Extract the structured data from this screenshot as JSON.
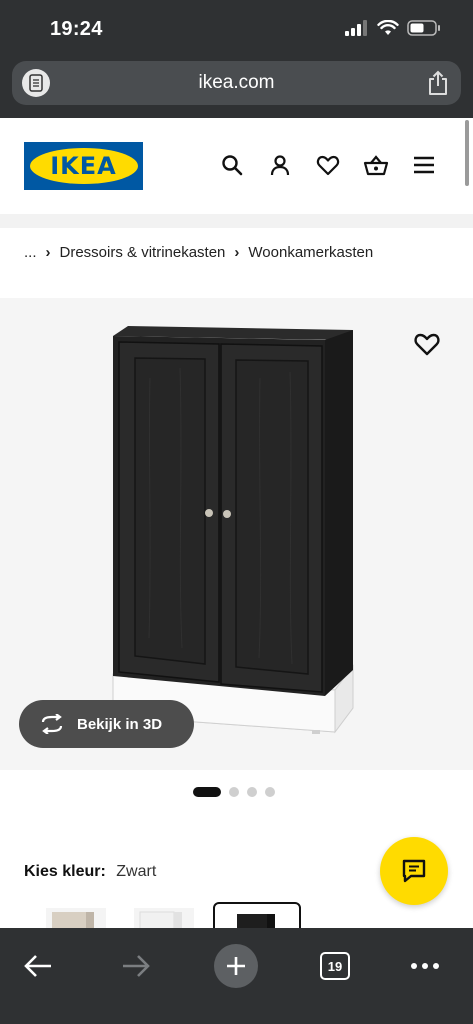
{
  "status_bar": {
    "time": "19:24"
  },
  "browser": {
    "url": "ikea.com",
    "tab_count": "19"
  },
  "header": {
    "logo_text": "IKEA"
  },
  "breadcrumb": {
    "ellipsis": "...",
    "items": [
      "Dressoirs & vitrinekasten",
      "Woonkamerkasten"
    ]
  },
  "product": {
    "view_3d_label": "Bekijk in 3D",
    "carousel_dots": 4,
    "active_dot": 0
  },
  "colour": {
    "label": "Kies kleur:",
    "value": "Zwart"
  },
  "colors": {
    "ikea_blue": "#0058a3",
    "ikea_yellow": "#ffdb00",
    "chrome": "#2f3133"
  }
}
